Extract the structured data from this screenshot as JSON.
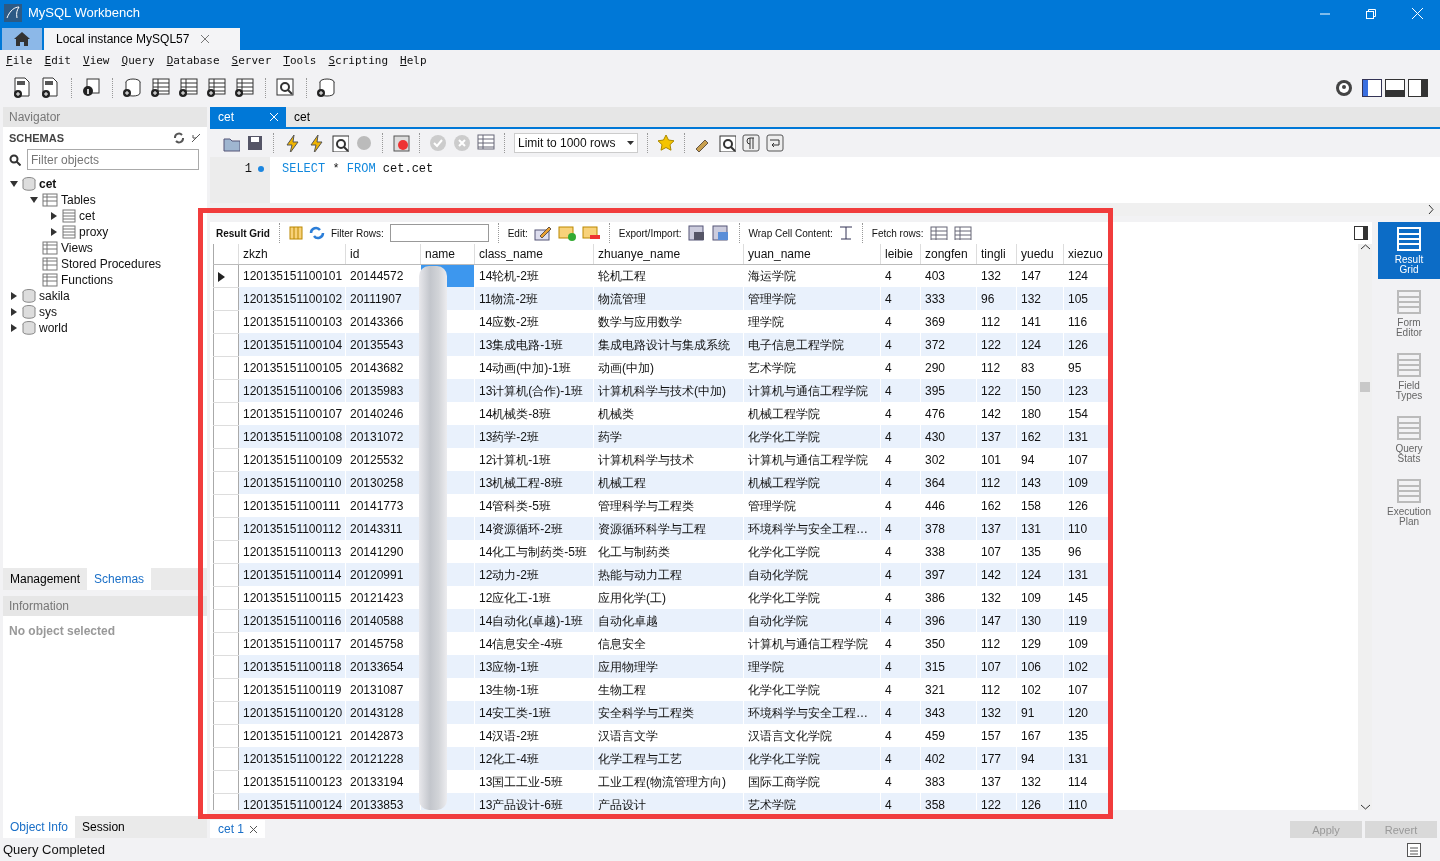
{
  "window": {
    "title": "MySQL Workbench"
  },
  "connection_tabs": [
    {
      "kind": "home",
      "selected": false
    },
    {
      "kind": "connection",
      "label": "Local instance MySQL57",
      "selected": true
    }
  ],
  "menu": [
    "File",
    "Edit",
    "View",
    "Query",
    "Database",
    "Server",
    "Tools",
    "Scripting",
    "Help"
  ],
  "navigator": {
    "title": "Navigator",
    "section": "SCHEMAS",
    "filter_placeholder": "Filter objects",
    "tree": [
      {
        "label": "cet",
        "kind": "schema",
        "default": true,
        "expanded": true,
        "children": [
          {
            "label": "Tables",
            "kind": "folder",
            "expanded": true,
            "children": [
              {
                "label": "cet",
                "kind": "table",
                "expanded": false
              },
              {
                "label": "proxy",
                "kind": "table",
                "expanded": false
              }
            ]
          },
          {
            "label": "Views",
            "kind": "folder"
          },
          {
            "label": "Stored Procedures",
            "kind": "folder"
          },
          {
            "label": "Functions",
            "kind": "folder"
          }
        ]
      },
      {
        "label": "sakila",
        "kind": "schema",
        "default": false,
        "expanded": false
      },
      {
        "label": "sys",
        "kind": "schema",
        "default": false,
        "expanded": false
      },
      {
        "label": "world",
        "kind": "schema",
        "default": false,
        "expanded": false
      }
    ]
  },
  "side_tabs": [
    {
      "label": "Management",
      "selected": false
    },
    {
      "label": "Schemas",
      "selected": true
    }
  ],
  "information": {
    "title": "Information",
    "text": "No object selected"
  },
  "info_tabs": [
    {
      "label": "Object Info",
      "selected": true
    },
    {
      "label": "Session",
      "selected": false
    }
  ],
  "editor_tabs": [
    {
      "label": "cet",
      "selected": true
    },
    {
      "label": "cet",
      "selected": false
    }
  ],
  "query_toolbar": {
    "limit": "Limit to 1000 rows"
  },
  "editor": {
    "lines": [
      {
        "number": "1",
        "tokens": [
          {
            "text": "SELECT",
            "kind": "keyword"
          },
          {
            "text": "*",
            "kind": "plain"
          },
          {
            "text": "FROM",
            "kind": "keyword"
          },
          {
            "text": "cet.cet",
            "kind": "plain"
          }
        ]
      }
    ]
  },
  "result_toolbar": {
    "title": "Result Grid",
    "filter_label": "Filter Rows:",
    "edit_label": "Edit:",
    "export_label": "Export/Import:",
    "wrap_label": "Wrap Cell Content:",
    "fetch_label": "Fetch rows:"
  },
  "grid": {
    "columns": [
      {
        "label": "zkzh"
      },
      {
        "label": "id"
      },
      {
        "label": "name",
        "redacted": true
      },
      {
        "label": "class_name"
      },
      {
        "label": "zhuanye_name"
      },
      {
        "label": "yuan_name"
      },
      {
        "label": "leibie"
      },
      {
        "label": "zongfen"
      },
      {
        "label": "tingli"
      },
      {
        "label": "yuedu"
      },
      {
        "label": "xiezuo"
      }
    ],
    "rows": [
      {
        "selected": true,
        "cells": [
          "120135151100101",
          "20144572",
          "",
          "14轮机-2班",
          "轮机工程",
          "海运学院",
          "4",
          "403",
          "132",
          "147",
          "124"
        ]
      },
      {
        "selected": false,
        "cells": [
          "120135151100102",
          "20111907",
          "",
          "11物流-2班",
          "物流管理",
          "管理学院",
          "4",
          "333",
          "96",
          "132",
          "105"
        ]
      },
      {
        "selected": false,
        "cells": [
          "120135151100103",
          "20143366",
          "",
          "14应数-2班",
          "数学与应用数学",
          "理学院",
          "4",
          "369",
          "112",
          "141",
          "116"
        ]
      },
      {
        "selected": false,
        "cells": [
          "120135151100104",
          "20135543",
          "",
          "13集成电路-1班",
          "集成电路设计与集成系统",
          "电子信息工程学院",
          "4",
          "372",
          "122",
          "124",
          "126"
        ]
      },
      {
        "selected": false,
        "cells": [
          "120135151100105",
          "20143682",
          "",
          "14动画(中加)-1班",
          "动画(中加)",
          "艺术学院",
          "4",
          "290",
          "112",
          "83",
          "95"
        ]
      },
      {
        "selected": false,
        "cells": [
          "120135151100106",
          "20135983",
          "",
          "13计算机(合作)-1班",
          "计算机科学与技术(中加)",
          "计算机与通信工程学院",
          "4",
          "395",
          "122",
          "150",
          "123"
        ]
      },
      {
        "selected": false,
        "cells": [
          "120135151100107",
          "20140246",
          "",
          "14机械类-8班",
          "机械类",
          "机械工程学院",
          "4",
          "476",
          "142",
          "180",
          "154"
        ]
      },
      {
        "selected": false,
        "cells": [
          "120135151100108",
          "20131072",
          "",
          "13药学-2班",
          "药学",
          "化学化工学院",
          "4",
          "430",
          "137",
          "162",
          "131"
        ]
      },
      {
        "selected": false,
        "cells": [
          "120135151100109",
          "20125532",
          "",
          "12计算机-1班",
          "计算机科学与技术",
          "计算机与通信工程学院",
          "4",
          "302",
          "101",
          "94",
          "107"
        ]
      },
      {
        "selected": false,
        "cells": [
          "120135151100110",
          "20130258",
          "",
          "13机械工程-8班",
          "机械工程",
          "机械工程学院",
          "4",
          "364",
          "112",
          "143",
          "109"
        ]
      },
      {
        "selected": false,
        "cells": [
          "120135151100111",
          "20141773",
          "",
          "14管科类-5班",
          "管理科学与工程类",
          "管理学院",
          "4",
          "446",
          "162",
          "158",
          "126"
        ]
      },
      {
        "selected": false,
        "cells": [
          "120135151100112",
          "20143311",
          "",
          "14资源循环-2班",
          "资源循环科学与工程",
          "环境科学与安全工程…",
          "4",
          "378",
          "137",
          "131",
          "110"
        ]
      },
      {
        "selected": false,
        "cells": [
          "120135151100113",
          "20141290",
          "",
          "14化工与制药类-5班",
          "化工与制药类",
          "化学化工学院",
          "4",
          "338",
          "107",
          "135",
          "96"
        ]
      },
      {
        "selected": false,
        "cells": [
          "120135151100114",
          "20120991",
          "",
          "12动力-2班",
          "热能与动力工程",
          "自动化学院",
          "4",
          "397",
          "142",
          "124",
          "131"
        ]
      },
      {
        "selected": false,
        "cells": [
          "120135151100115",
          "20121423",
          "",
          "12应化工-1班",
          "应用化学(工)",
          "化学化工学院",
          "4",
          "386",
          "132",
          "109",
          "145"
        ]
      },
      {
        "selected": false,
        "cells": [
          "120135151100116",
          "20140588",
          "",
          "14自动化(卓越)-1班",
          "自动化卓越",
          "自动化学院",
          "4",
          "396",
          "147",
          "130",
          "119"
        ]
      },
      {
        "selected": false,
        "cells": [
          "120135151100117",
          "20145758",
          "",
          "14信息安全-4班",
          "信息安全",
          "计算机与通信工程学院",
          "4",
          "350",
          "112",
          "129",
          "109"
        ]
      },
      {
        "selected": false,
        "cells": [
          "120135151100118",
          "20133654",
          "",
          "13应物-1班",
          "应用物理学",
          "理学院",
          "4",
          "315",
          "107",
          "106",
          "102"
        ]
      },
      {
        "selected": false,
        "cells": [
          "120135151100119",
          "20131087",
          "",
          "13生物-1班",
          "生物工程",
          "化学化工学院",
          "4",
          "321",
          "112",
          "102",
          "107"
        ]
      },
      {
        "selected": false,
        "cells": [
          "120135151100120",
          "20143128",
          "",
          "14安工类-1班",
          "安全科学与工程类",
          "环境科学与安全工程…",
          "4",
          "343",
          "132",
          "91",
          "120"
        ]
      },
      {
        "selected": false,
        "cells": [
          "120135151100121",
          "20142873",
          "",
          "14汉语-2班",
          "汉语言文学",
          "汉语言文化学院",
          "4",
          "459",
          "157",
          "167",
          "135"
        ]
      },
      {
        "selected": false,
        "cells": [
          "120135151100122",
          "20121228",
          "",
          "12化工-4班",
          "化学工程与工艺",
          "化学化工学院",
          "4",
          "402",
          "177",
          "94",
          "131"
        ]
      },
      {
        "selected": false,
        "cells": [
          "120135151100123",
          "20133194",
          "",
          "13国工工业-5班",
          "工业工程(物流管理方向)",
          "国际工商学院",
          "4",
          "383",
          "137",
          "132",
          "114"
        ]
      },
      {
        "selected": false,
        "cells": [
          "120135151100124",
          "20133853",
          "",
          "13产品设计-6班",
          "产品设计",
          "艺术学院",
          "4",
          "358",
          "122",
          "126",
          "110"
        ]
      }
    ]
  },
  "result_tabs": [
    {
      "label": "cet 1",
      "selected": true
    }
  ],
  "right_panel": [
    {
      "label": "Result Grid",
      "selected": true
    },
    {
      "label": "Form Editor",
      "selected": false
    },
    {
      "label": "Field Types",
      "selected": false
    },
    {
      "label": "Query Stats",
      "selected": false
    },
    {
      "label": "Execution Plan",
      "selected": false
    }
  ],
  "action_buttons": [
    {
      "label": "Apply",
      "disabled": true
    },
    {
      "label": "Revert",
      "disabled": true
    }
  ],
  "status_bar": {
    "text": "Query Completed"
  }
}
